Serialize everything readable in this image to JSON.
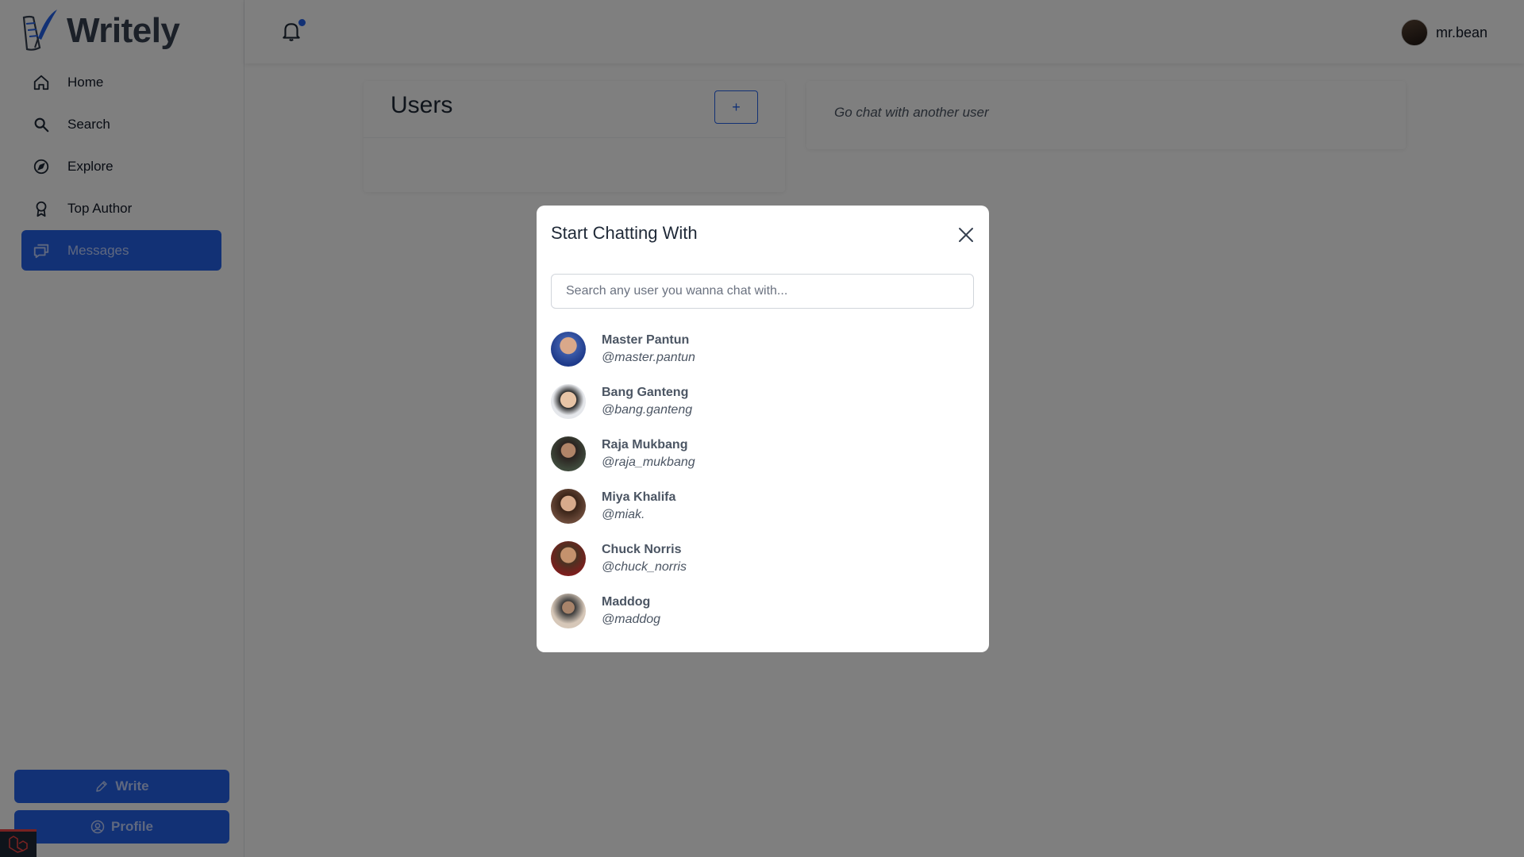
{
  "brand": {
    "name": "Writely"
  },
  "nav": [
    {
      "label": "Home",
      "icon": "home-icon"
    },
    {
      "label": "Search",
      "icon": "search-icon"
    },
    {
      "label": "Explore",
      "icon": "compass-icon"
    },
    {
      "label": "Top Author",
      "icon": "award-icon"
    },
    {
      "label": "Messages",
      "icon": "chat-icon",
      "active": true
    }
  ],
  "sidebar_actions": {
    "write_label": "Write",
    "profile_label": "Profile"
  },
  "topbar": {
    "username": "mr.bean"
  },
  "users_panel": {
    "title": "Users",
    "add_label": "+"
  },
  "chat_panel": {
    "placeholder_text": "Go chat with another user"
  },
  "modal": {
    "title": "Start Chatting With",
    "search_placeholder": "Search any user you wanna chat with...",
    "users": [
      {
        "name": "Master Pantun",
        "handle": "@master.pantun"
      },
      {
        "name": "Bang Ganteng",
        "handle": "@bang.ganteng"
      },
      {
        "name": "Raja Mukbang",
        "handle": "@raja_mukbang"
      },
      {
        "name": "Miya Khalifa",
        "handle": "@miak."
      },
      {
        "name": "Chuck Norris",
        "handle": "@chuck_norris"
      },
      {
        "name": "Maddog",
        "handle": "@maddog"
      }
    ]
  },
  "colors": {
    "accent": "#2563eb",
    "overlay": "rgba(0,0,0,0.5)"
  }
}
